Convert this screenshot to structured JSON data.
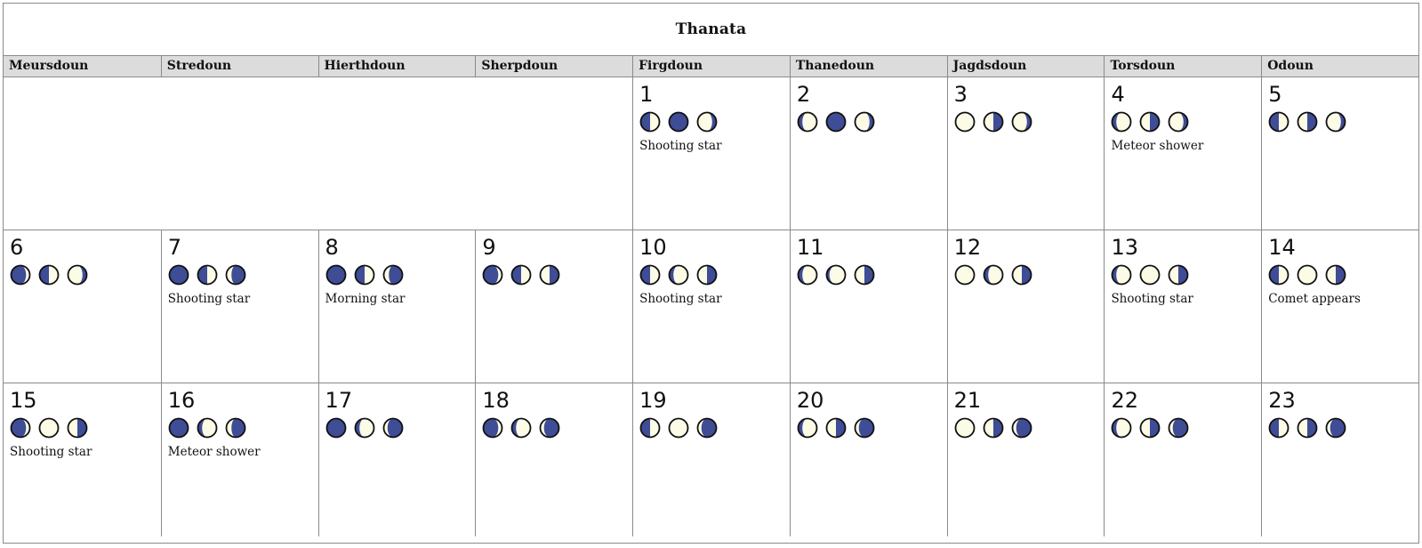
{
  "calendar": {
    "title": "Thanata",
    "weekdays": [
      "Meursdoun",
      "Stredoun",
      "Hierthdoun",
      "Sherpdoun",
      "Firgdoun",
      "Thanedoun",
      "Jagdsdoun",
      "Torsdoun",
      "Odoun"
    ],
    "colors": {
      "dark": "#3f4c96",
      "light": "#fcfbe6",
      "outline": "#111111"
    },
    "weeks": [
      [
        null,
        null,
        null,
        null,
        {
          "day": "1",
          "moons": [
            "first-quarter",
            "new",
            "waxing-crescent"
          ],
          "event": "Shooting star"
        },
        {
          "day": "2",
          "moons": [
            "waning-crescent",
            "new",
            "waxing-crescent"
          ],
          "event": ""
        },
        {
          "day": "3",
          "moons": [
            "full",
            "last-quarter",
            "waxing-crescent"
          ],
          "event": ""
        },
        {
          "day": "4",
          "moons": [
            "waning-gibbous",
            "last-quarter",
            "waxing-crescent"
          ],
          "event": "Meteor shower"
        },
        {
          "day": "5",
          "moons": [
            "first-quarter",
            "last-quarter",
            "waxing-crescent"
          ],
          "event": ""
        }
      ],
      [
        {
          "day": "6",
          "moons": [
            "waning-gibbous-dark",
            "first-quarter",
            "waxing-crescent"
          ],
          "event": ""
        },
        {
          "day": "7",
          "moons": [
            "new",
            "first-quarter",
            "waxing-gibbous"
          ],
          "event": "Shooting star"
        },
        {
          "day": "8",
          "moons": [
            "new",
            "first-quarter",
            "waxing-gibbous"
          ],
          "event": "Morning star"
        },
        {
          "day": "9",
          "moons": [
            "waning-gibbous-dark",
            "first-quarter",
            "waxing-quarter"
          ],
          "event": ""
        },
        {
          "day": "10",
          "moons": [
            "first-quarter",
            "waning-crescent",
            "waxing-quarter"
          ],
          "event": "Shooting star"
        },
        {
          "day": "11",
          "moons": [
            "waning-crescent",
            "full-crescent",
            "waxing-quarter"
          ],
          "event": ""
        },
        {
          "day": "12",
          "moons": [
            "full",
            "waning-crescent",
            "waxing-quarter"
          ],
          "event": ""
        },
        {
          "day": "13",
          "moons": [
            "waning-gibbous",
            "full",
            "waxing-quarter"
          ],
          "event": "Shooting star"
        },
        {
          "day": "14",
          "moons": [
            "first-quarter",
            "full",
            "waxing-quarter"
          ],
          "event": "Comet appears"
        }
      ],
      [
        {
          "day": "15",
          "moons": [
            "waning-gibbous-dark",
            "full",
            "waxing-quarter"
          ],
          "event": "Shooting star"
        },
        {
          "day": "16",
          "moons": [
            "new",
            "waning-gibbous",
            "waxing-gibbous"
          ],
          "event": "Meteor shower"
        },
        {
          "day": "17",
          "moons": [
            "new",
            "waning-gibbous",
            "waxing-gibbous-dark"
          ],
          "event": ""
        },
        {
          "day": "18",
          "moons": [
            "waning-gibbous-dark",
            "waning-gibbous",
            "waxing-gibbous-dark"
          ],
          "event": ""
        },
        {
          "day": "19",
          "moons": [
            "first-quarter",
            "full",
            "waxing-gibbous-dark"
          ],
          "event": ""
        },
        {
          "day": "20",
          "moons": [
            "waning-crescent",
            "waxing-quarter",
            "waxing-gibbous-dark"
          ],
          "event": ""
        },
        {
          "day": "21",
          "moons": [
            "full",
            "last-quarter",
            "waxing-gibbous-dark"
          ],
          "event": ""
        },
        {
          "day": "22",
          "moons": [
            "waning-gibbous",
            "waxing-quarter",
            "waxing-gibbous-dark"
          ],
          "event": ""
        },
        {
          "day": "23",
          "moons": [
            "first-quarter",
            "last-quarter",
            "waxing-gibbous-dark"
          ],
          "event": ""
        }
      ]
    ]
  }
}
